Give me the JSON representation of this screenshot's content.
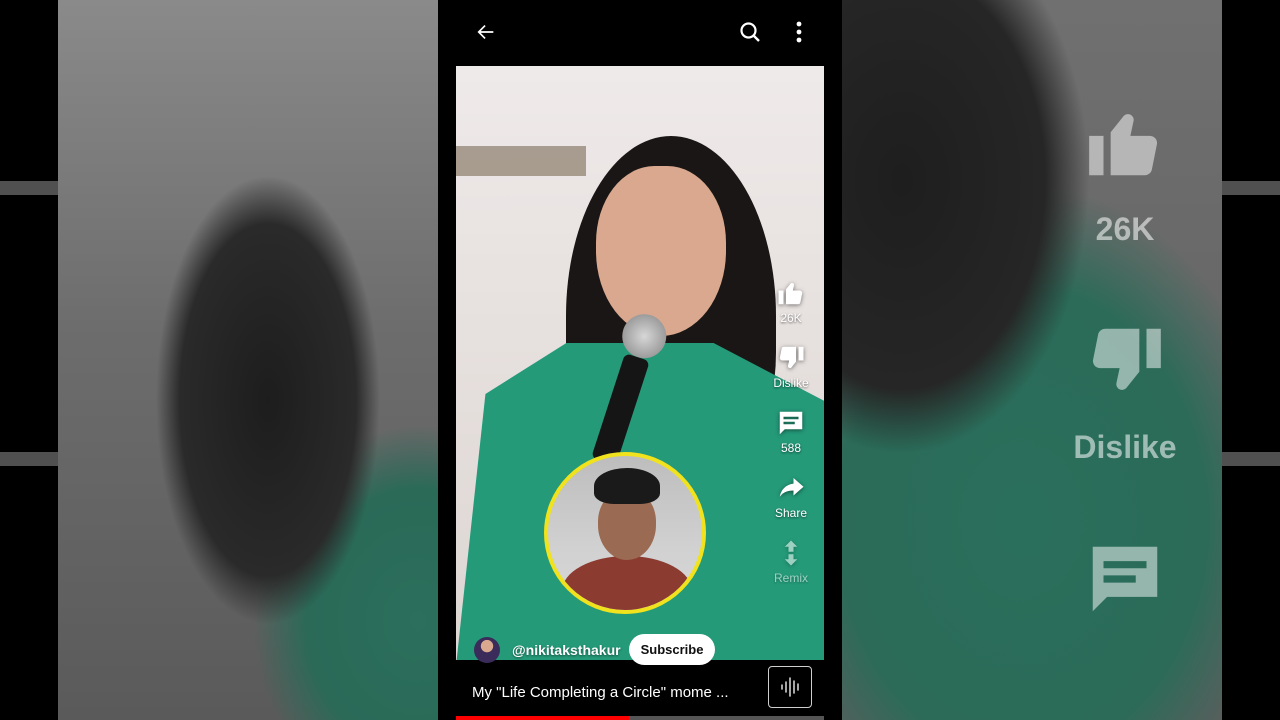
{
  "top_bar": {
    "back_icon": "arrow-left-icon",
    "search_icon": "search-icon",
    "more_icon": "more-vertical-icon"
  },
  "actions": {
    "like_count": "26K",
    "dislike_label": "Dislike",
    "comment_count": "588",
    "share_label": "Share",
    "remix_label": "Remix"
  },
  "channel": {
    "handle": "@nikitaksthakur",
    "subscribe_label": "Subscribe"
  },
  "video": {
    "title": "My \"Life Completing a Circle\" mome ...",
    "progress": 0.47
  },
  "background_overlay": {
    "like_count": "26K",
    "dislike_label": "Dislike"
  },
  "colors": {
    "accent_progress": "#ff0000",
    "reaction_ring": "#f0e21d",
    "jacket": "#249a79"
  }
}
